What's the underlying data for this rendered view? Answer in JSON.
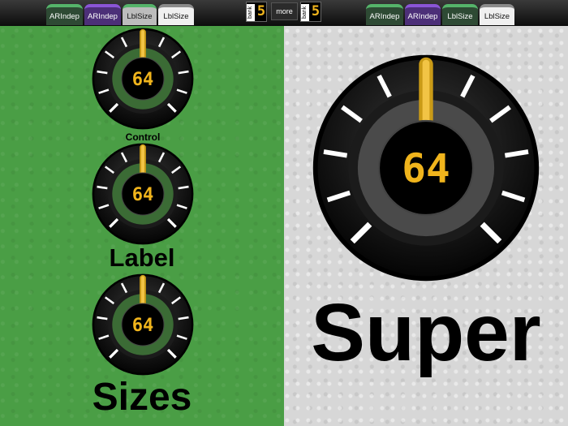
{
  "tabs_left": [
    {
      "label": "ARIndep",
      "style": "green"
    },
    {
      "label": "ARIndep",
      "style": "purple"
    },
    {
      "label": "LblSize",
      "style": "selected"
    },
    {
      "label": "LblSize",
      "style": "white"
    }
  ],
  "tabs_right": [
    {
      "label": "ARIndep",
      "style": "green"
    },
    {
      "label": "ARIndep",
      "style": "purple"
    },
    {
      "label": "LblSize",
      "style": "green"
    },
    {
      "label": "LblSize",
      "style": "white"
    }
  ],
  "bank_left": {
    "label": "bank",
    "value": "5"
  },
  "bank_right": {
    "label": "bank",
    "value": "5"
  },
  "more_label": "more",
  "knob_value": "64",
  "labels": {
    "control": "Control",
    "label": "Label",
    "sizes": "Sizes",
    "super": "Super"
  },
  "colors": {
    "green_bg": "#4a9e45",
    "gray_bg": "#d7d7d7",
    "display_digits": "#f0b41c",
    "knob_body": "#111111"
  }
}
